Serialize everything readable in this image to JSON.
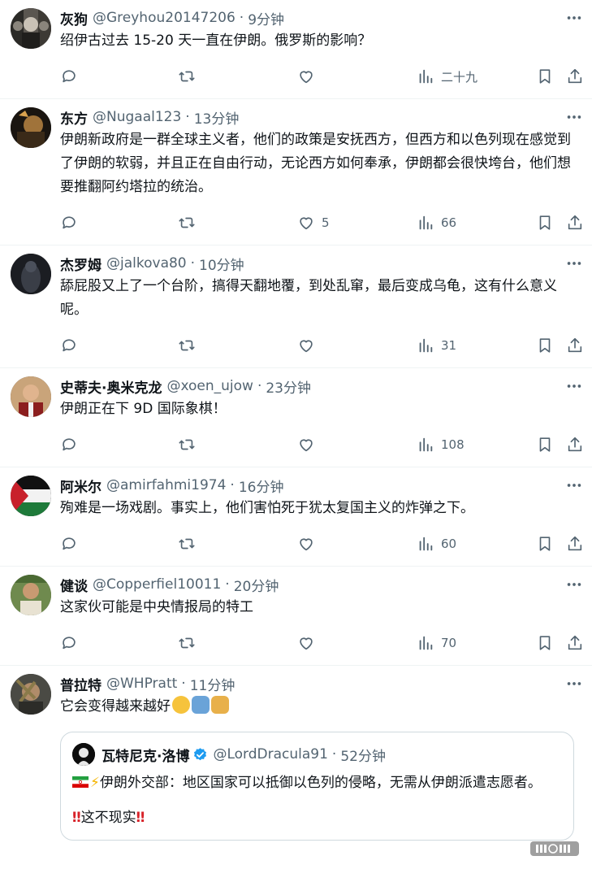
{
  "icons": {
    "reply": "reply-icon",
    "retweet": "retweet-icon",
    "like": "heart-icon",
    "views": "views-icon",
    "bookmark": "bookmark-icon",
    "share": "share-icon",
    "more": "more-icon"
  },
  "tweets": [
    {
      "name": "灰狗",
      "handle": "@Greyhou20147206",
      "time": "9分钟",
      "text": "绍伊古过去 15-20 天一直在伊朗。俄罗斯的影响？",
      "likes": "",
      "views": "二十九"
    },
    {
      "name": "东方",
      "handle": "@Nugaal123",
      "time": "13分钟",
      "text": "伊朗新政府是一群全球主义者，他们的政策是安抚西方，但西方和以色列现在感觉到了伊朗的软弱，并且正在自由行动，无论西方如何奉承，伊朗都会很快垮台，他们想要推翻阿约塔拉的统治。",
      "likes": "5",
      "views": "66"
    },
    {
      "name": "杰罗姆",
      "handle": "@jalkova80",
      "time": "10分钟",
      "text": "舔屁股又上了一个台阶，搞得天翻地覆，到处乱窜，最后变成乌龟，这有什么意义呢。",
      "likes": "",
      "views": "31"
    },
    {
      "name": "史蒂夫·奥米克龙",
      "handle": "@xoen_ujow",
      "time": "23分钟",
      "text": "伊朗正在下 9D 国际象棋！",
      "likes": "",
      "views": "108"
    },
    {
      "name": "阿米尔",
      "handle": "@amirfahmi1974",
      "time": "16分钟",
      "text": "殉难是一场戏剧。事实上，他们害怕死于犹太复国主义的炸弹之下。",
      "likes": "",
      "views": "60"
    },
    {
      "name": "健谈",
      "handle": "@Copperfiel10011",
      "time": "20分钟",
      "text": "这家伙可能是中央情报局的特工",
      "likes": "",
      "views": "70"
    },
    {
      "name": "普拉特",
      "handle": "@WHPratt",
      "time": "11分钟",
      "text": "它会变得越来越好"
    }
  ],
  "quote": {
    "name": "瓦特尼克·洛博",
    "handle": "@LordDracula91",
    "time": "52分钟",
    "line1": "伊朗外交部：地区国家可以抵御以色列的侵略，无需从伊朗派遣志愿者。",
    "line2": "这不现实",
    "bang": "‼"
  },
  "colors": {
    "text": "#0f1419",
    "secondary": "#536471",
    "divider": "#eff3f4",
    "verified": "#1d9bf0"
  }
}
